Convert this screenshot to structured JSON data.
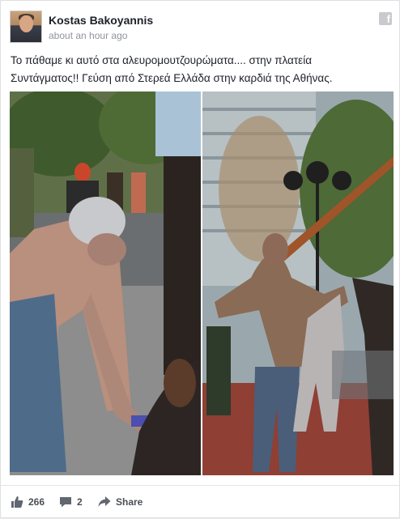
{
  "post": {
    "author": "Kostas Bakoyannis",
    "timestamp": "about an hour ago",
    "text_line1": "Το πάθαμε κι αυτό στα αλευρομουτζουρώματα.... στην πλατεία",
    "text_line2": "Συντάγματος!! Γεύση από Στερεά Ελλάδα στην καρδιά της Αθήνας."
  },
  "icons": {
    "facebook": "facebook-icon",
    "like": "thumbs-up-icon",
    "comment": "comment-icon",
    "share": "share-arrow-icon"
  },
  "footer": {
    "likes": "266",
    "comments": "2",
    "share_label": "Share"
  },
  "colors": {
    "author": "#1d2129",
    "meta": "#90949c",
    "action": "#4b4f56"
  }
}
